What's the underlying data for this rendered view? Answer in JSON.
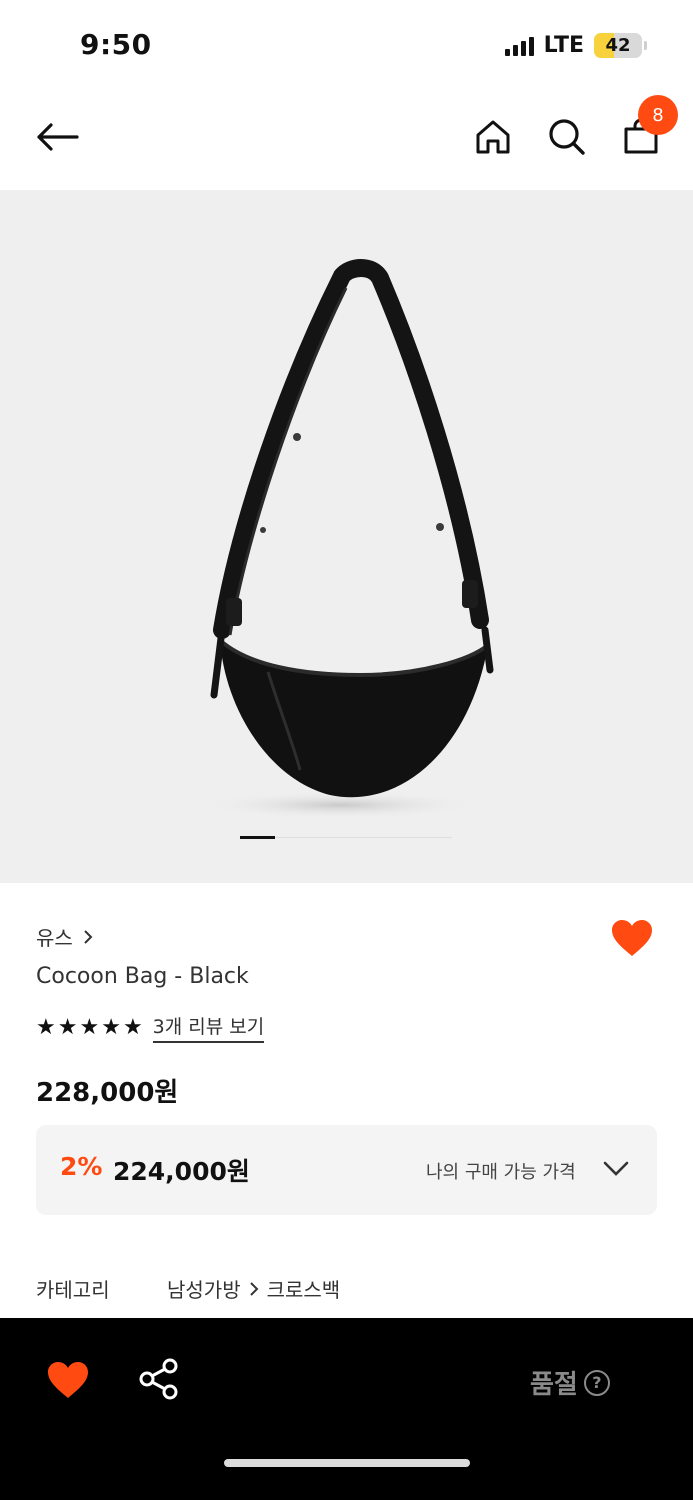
{
  "status": {
    "time": "9:50",
    "network": "LTE",
    "battery": "42",
    "battery_fraction": 0.42
  },
  "header": {
    "cart_count": "8",
    "icons": {
      "back": "arrow-left-icon",
      "home": "home-icon",
      "search": "search-icon",
      "cart": "shopping-bag-icon"
    }
  },
  "product": {
    "image_alt": "black crescent shoulder bag",
    "carousel": {
      "current": 1,
      "total": 6
    },
    "brand": "유스",
    "name": "Cocoon Bag - Black",
    "rating": 5,
    "review_link": "3개 리뷰 보기",
    "price": "228,000원",
    "discount_rate": "2%",
    "discount_price": "224,000원",
    "my_price_label": "나의 구매 가능 가격",
    "category_label": "카테고리",
    "category_main": "남성가방",
    "category_sub": "크로스백",
    "liked": true
  },
  "bottom_bar": {
    "status_label": "품절",
    "help_symbol": "?"
  },
  "colors": {
    "accent": "#ff4b12",
    "bottom_bar": "#000000",
    "image_bg": "#efefef"
  }
}
